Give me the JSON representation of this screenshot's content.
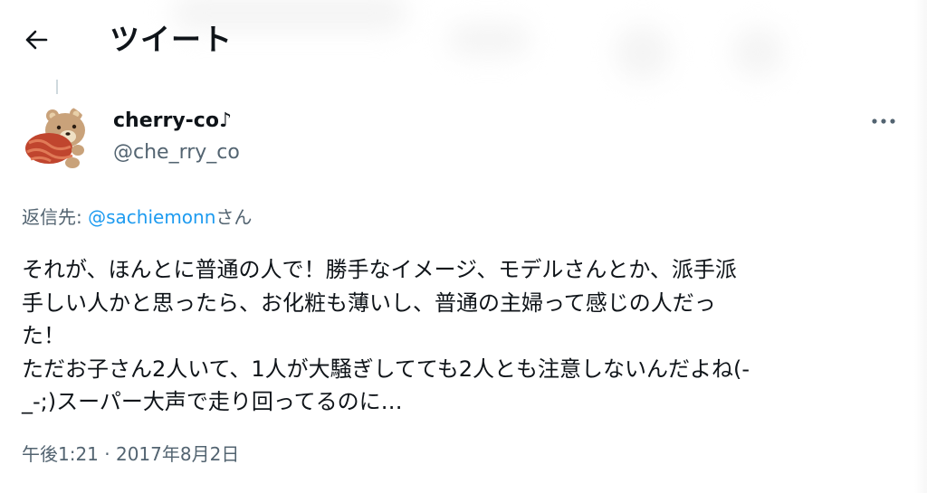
{
  "header": {
    "title": "ツイート"
  },
  "author": {
    "name": "cherry-co♪",
    "handle": "@che_rry_co"
  },
  "reply": {
    "prefix": "返信先: ",
    "mention": "@sachiemonn",
    "suffix": "さん"
  },
  "tweet": {
    "lines": [
      "それが、ほんとに普通の人で！勝手なイメージ、モデルさんとか、派手派",
      "手しい人かと思ったら、お化粧も薄いし、普通の主婦って感じの人だっ",
      "た！",
      "ただお子さん2人いて、1人が大騒ぎしてても2人とも注意しないんだよね(-",
      "_-;)スーパー大声で走り回ってるのに…"
    ]
  },
  "meta": {
    "timestamp": "午後1:21 · 2017年8月2日"
  },
  "icons": {
    "back": "back-arrow-icon",
    "more": "more-horizontal-icon"
  },
  "colors": {
    "text": "#0f1419",
    "secondary": "#536471",
    "link": "#1d9bf0"
  }
}
